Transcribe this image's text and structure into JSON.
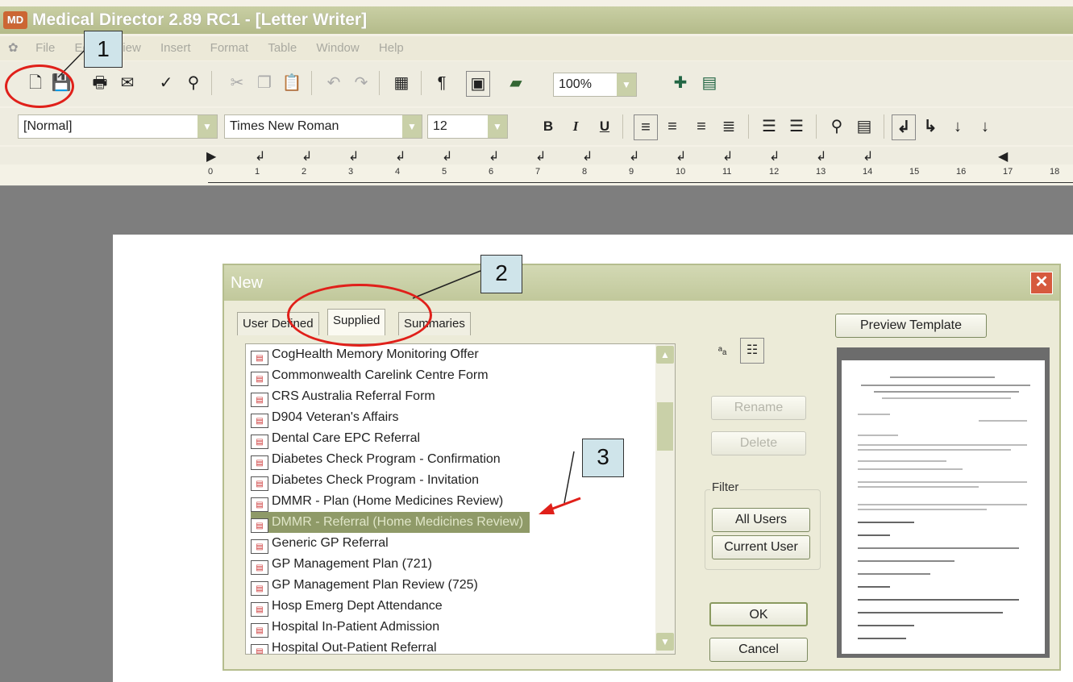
{
  "window": {
    "title": "Medical Director 2.89 RC1 - [Letter Writer]",
    "logo_text": "MD"
  },
  "menu": [
    "File",
    "Edit",
    "View",
    "Insert",
    "Format",
    "Table",
    "Window",
    "Help"
  ],
  "toolbar": {
    "zoom": "100%"
  },
  "format_bar": {
    "style": "[Normal]",
    "font": "Times New Roman",
    "size": "12",
    "bold": "B",
    "italic": "I",
    "underline": "U"
  },
  "ruler": {
    "numbers": [
      "0",
      "1",
      "2",
      "3",
      "4",
      "5",
      "6",
      "7",
      "8",
      "9",
      "10",
      "11",
      "12",
      "13",
      "14",
      "15",
      "16",
      "17",
      "18"
    ]
  },
  "dialog": {
    "title": "New",
    "close": "✕",
    "tabs": [
      "User Defined",
      "Supplied",
      "Summaries"
    ],
    "active_tab": "Supplied",
    "templates": [
      "CogHealth Memory Monitoring Offer",
      "Commonwealth Carelink Centre Form",
      "CRS Australia Referral Form",
      "D904 Veteran's Affairs",
      "Dental Care EPC Referral",
      "Diabetes Check Program - Confirmation",
      "Diabetes Check Program - Invitation",
      "DMMR - Plan (Home Medicines Review)",
      "DMMR - Referral (Home Medicines Review)",
      "Generic GP Referral",
      "GP Management Plan (721)",
      "GP Management Plan Review (725)",
      "Hosp Emerg Dept Attendance",
      "Hospital In-Patient Admission",
      "Hospital Out-Patient Referral"
    ],
    "selected_index": 8,
    "buttons": {
      "rename": "Rename",
      "delete": "Delete",
      "filter": "Filter",
      "all_users": "All Users",
      "current_user": "Current User",
      "ok": "OK",
      "cancel": "Cancel",
      "preview": "Preview Template"
    }
  },
  "annotations": [
    "1",
    "2",
    "3"
  ],
  "colors": {
    "accent": "#b5bd8e",
    "selection": "#8f9a68",
    "annotation": "#e0201a",
    "callout": "#cfe4ea"
  }
}
